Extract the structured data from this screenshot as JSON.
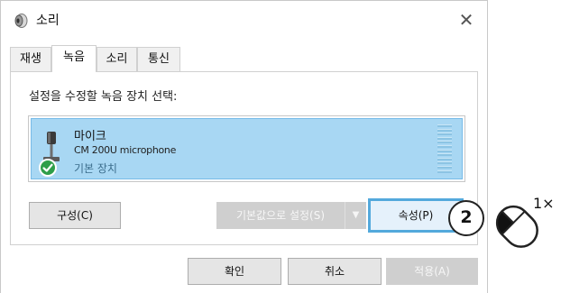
{
  "window": {
    "title": "소리",
    "close_glyph": "✕"
  },
  "tabs": [
    {
      "label": "재생",
      "active": false
    },
    {
      "label": "녹음",
      "active": true
    },
    {
      "label": "소리",
      "active": false
    },
    {
      "label": "통신",
      "active": false
    }
  ],
  "panel": {
    "prompt": "설정을 수정할 녹음 장치 선택:",
    "device": {
      "name": "마이크",
      "model": "CM 200U microphone",
      "status": "기본 장치",
      "icon": "microphone-icon",
      "badge_icon": "check-icon"
    },
    "buttons": {
      "configure": "구성(C)",
      "set_default": "기본값으로 설정(S)",
      "set_default_arrow": "▼",
      "properties": "속성(P)"
    }
  },
  "footer": {
    "ok": "확인",
    "cancel": "취소",
    "apply": "적용(A)"
  },
  "annotation": {
    "step": "2",
    "mouse_icon": "mouse-left-click-icon",
    "click_count": "1×"
  },
  "colors": {
    "selection": "#a8d7f3",
    "selection_border": "#77bbe8",
    "highlight_border": "#53a9dc",
    "check": "#2e9e4a"
  }
}
